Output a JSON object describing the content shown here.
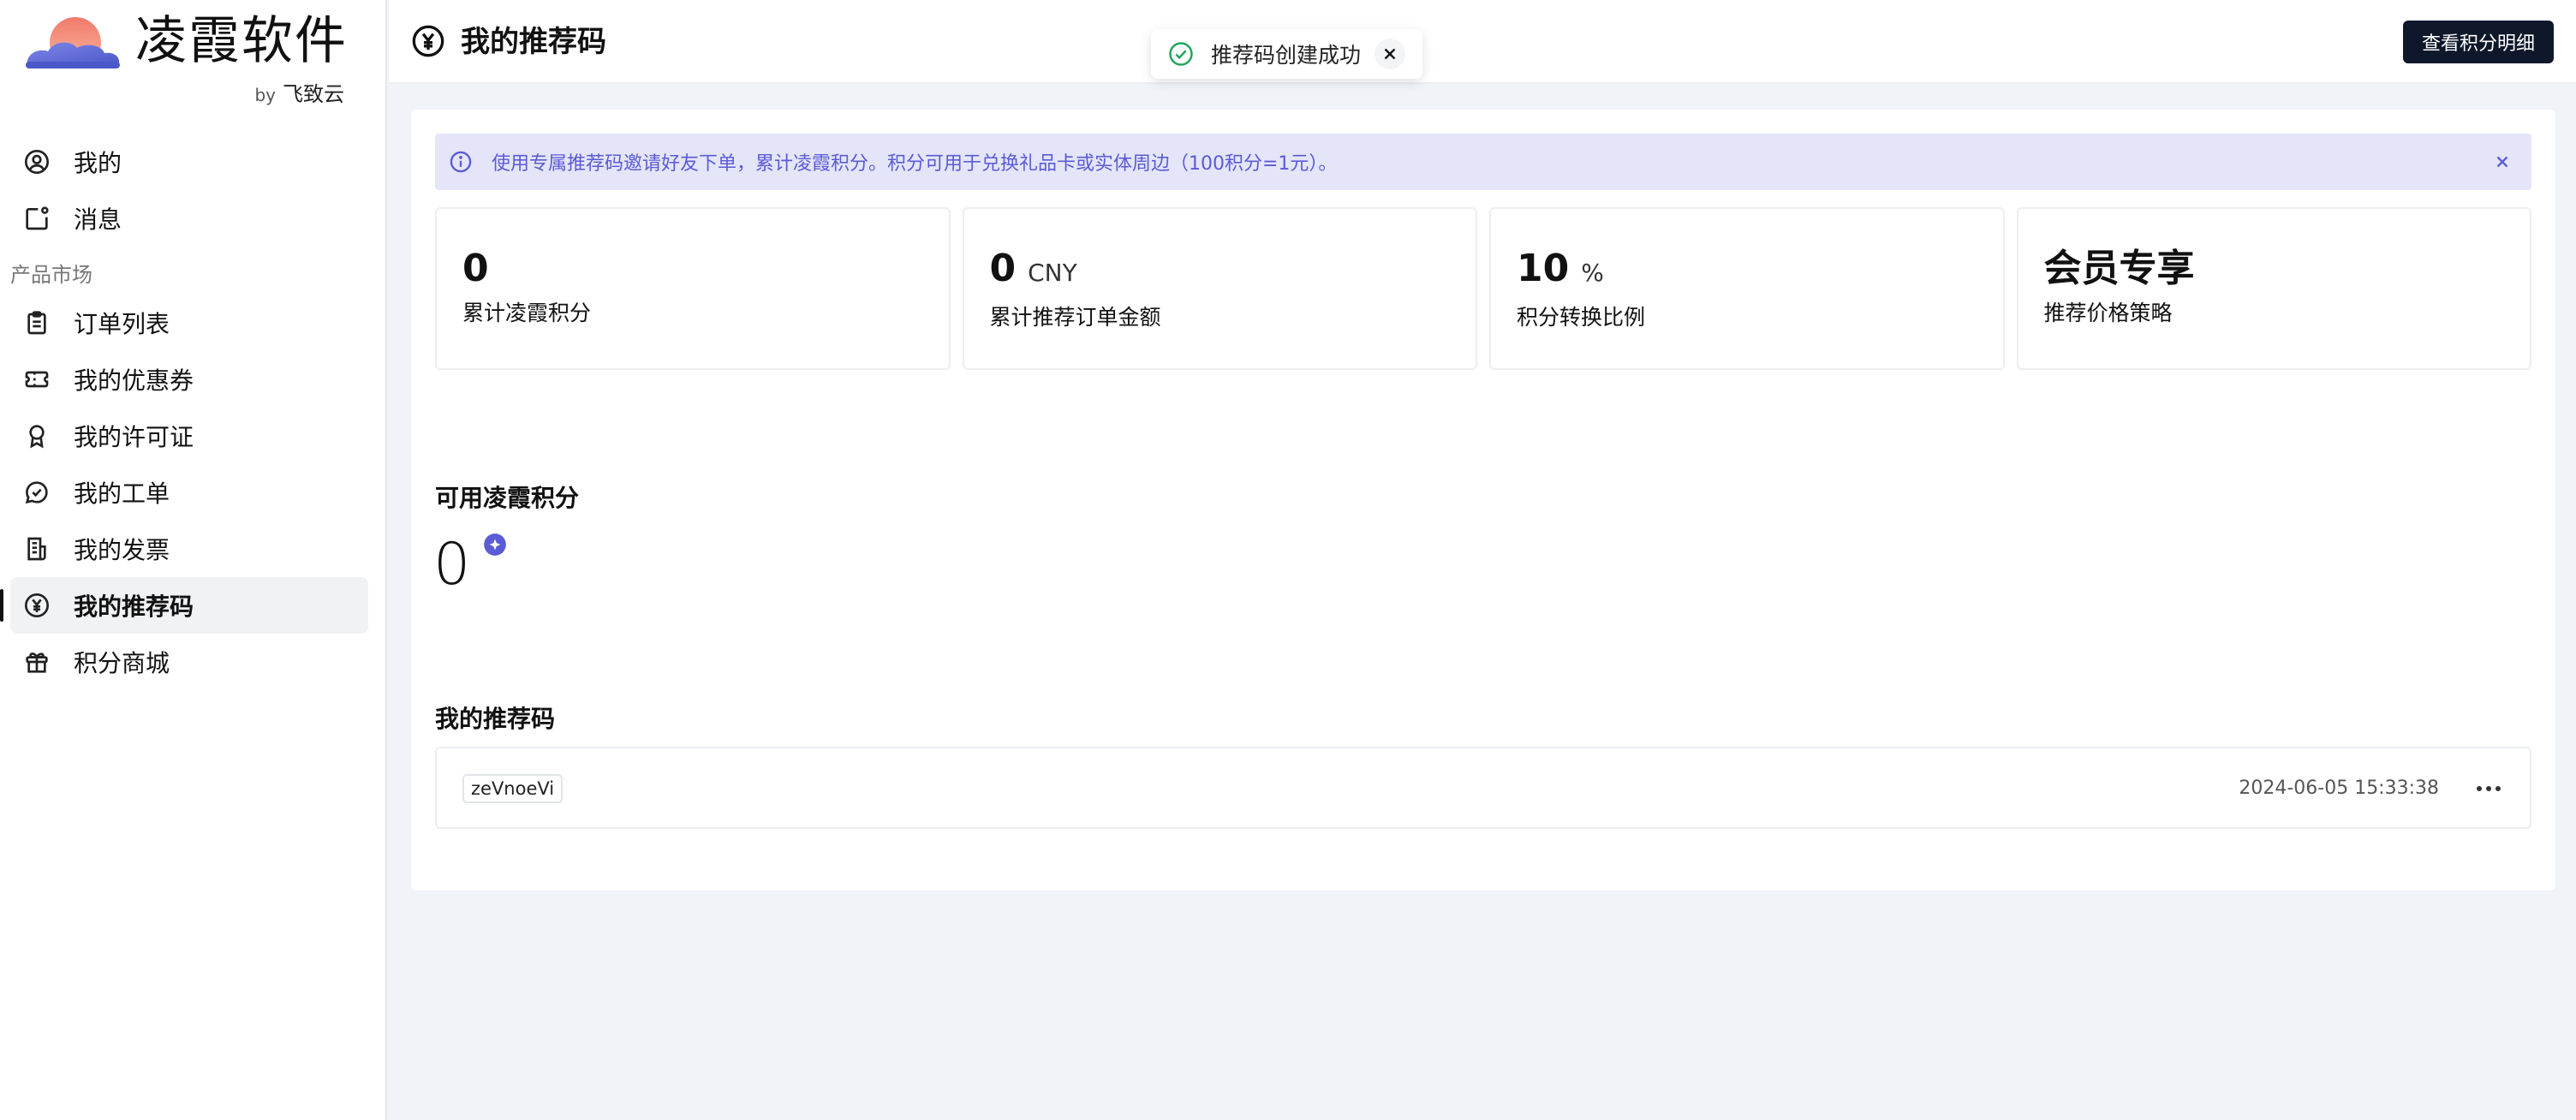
{
  "brand": {
    "title": "凌霞软件",
    "by": "by",
    "by_company": "飞致云"
  },
  "sidebar": {
    "items_top": [
      {
        "label": "我的",
        "icon": "user-circle-icon"
      },
      {
        "label": "消息",
        "icon": "message-notification-icon"
      }
    ],
    "section_label": "产品市场",
    "items": [
      {
        "label": "订单列表",
        "icon": "clipboard-icon"
      },
      {
        "label": "我的优惠券",
        "icon": "ticket-icon"
      },
      {
        "label": "我的许可证",
        "icon": "award-icon"
      },
      {
        "label": "我的工单",
        "icon": "chat-check-icon"
      },
      {
        "label": "我的发票",
        "icon": "receipt-icon"
      },
      {
        "label": "我的推荐码",
        "icon": "yen-circle-icon",
        "active": true
      },
      {
        "label": "积分商城",
        "icon": "gift-icon"
      }
    ]
  },
  "header": {
    "title": "我的推荐码",
    "button_label": "查看积分明细"
  },
  "toast": {
    "text": "推荐码创建成功"
  },
  "alert": {
    "text": "使用专属推荐码邀请好友下单，累计凌霞积分。积分可用于兑换礼品卡或实体周边（100积分=1元）。"
  },
  "stats": [
    {
      "value": "0",
      "unit": "",
      "label": "累计凌霞积分"
    },
    {
      "value": "0",
      "unit": "CNY",
      "label": "累计推荐订单金额"
    },
    {
      "value": "10",
      "unit": "%",
      "label": "积分转换比例"
    },
    {
      "value": "会员专享",
      "unit": "",
      "label": "推荐价格策略"
    }
  ],
  "available": {
    "title": "可用凌霞积分",
    "value": "0"
  },
  "codes": {
    "title": "我的推荐码",
    "rows": [
      {
        "code": "zeVnoeVi",
        "created": "2024-06-05 15:33:38"
      }
    ]
  },
  "colors": {
    "accent": "#5b5bd6",
    "dark_button": "#0f172a",
    "success": "#22a75a"
  }
}
